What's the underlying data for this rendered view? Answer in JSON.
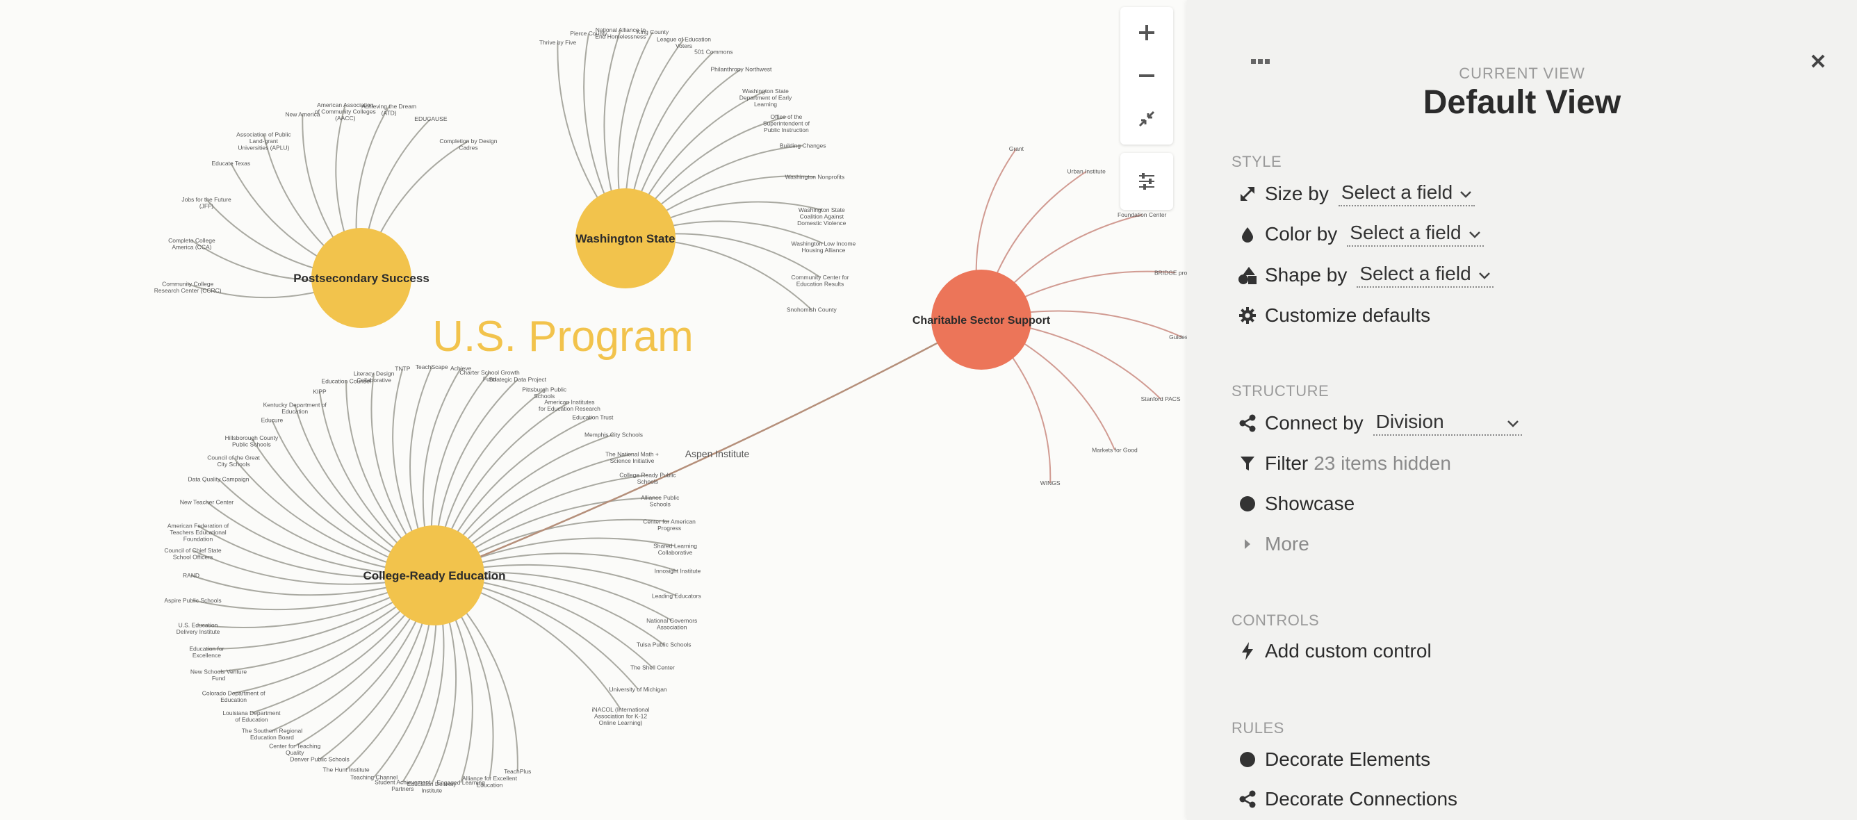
{
  "graph": {
    "region_label": "U.S. Program",
    "hubs": [
      {
        "id": "postsecondary",
        "name": "Postsecondary Success",
        "color": "#f2c34c",
        "line_color": "#9a9a92",
        "leaves": [
          "Community College Research Center (CCRC)",
          "Complete College America (CCA)",
          "Jobs for the Future (JFF)",
          "Educate Texas",
          "Association of Public Land-grant Universities (APLU)",
          "New America",
          "American Association of Community Colleges (AACC)",
          "Achieving the Dream (ATD)",
          "EDUCAUSE",
          "Completion by Design Cadres"
        ]
      },
      {
        "id": "washington",
        "name": "Washington State",
        "color": "#f2c34c",
        "line_color": "#9a9a92",
        "leaves": [
          "Thrive by Five",
          "Pierce County",
          "National Alliance to End Homelessness",
          "King County",
          "League of Education Voters",
          "501 Commons",
          "Philanthropy Northwest",
          "Washington State Department of Early Learning",
          "Office of the Superintendent of Public Instruction",
          "Building Changes",
          "Washington Nonprofits",
          "Washington State Coalition Against Domestic Violence",
          "Washington Low Income Housing Alliance",
          "Community Center for Education Results",
          "Snohomish County"
        ]
      },
      {
        "id": "college_ready",
        "name": "College-Ready Education",
        "color": "#f2c34c",
        "line_color": "#9a9a92",
        "leaves": [
          "TeachPlus",
          "Alliance for Excellent Education",
          "Engaged Learning",
          "Education Delivery Institute",
          "Student Achievement Partners",
          "Teaching Channel",
          "The Hunt Institute",
          "Denver Public Schools",
          "Center for Teaching Quality",
          "The Southern Regional Education Board",
          "Louisiana Department of Education",
          "Colorado Department of Education",
          "New Schools Venture Fund",
          "Education for Excellence",
          "U.S. Education Delivery Institute",
          "Aspire Public Schools",
          "RAND",
          "Council of Chief State School Officers",
          "American Federation of Teachers Educational Foundation",
          "New Teacher Center",
          "Data Quality Campaign",
          "Council of the Great City Schools",
          "Hillsborough County Public Schools",
          "Educure",
          "Kentucky Department of Education",
          "KIPP",
          "Education Counsel",
          "Literacy Design Collaborative",
          "TNTP",
          "TeachScape",
          "Achieve",
          "Charter School Growth Fund",
          "Strategic Data Project",
          "Pittsburgh Public Schools",
          "American Institutes for Education Research",
          "Education Trust",
          "Memphis City Schools",
          "The National Math + Science Initiative",
          "College Ready Public Schools",
          "Alliance Public Schools",
          "Center for American Progress",
          "Shared Learning Collaborative",
          "Innosight Institute",
          "Leading Educators",
          "National Governors Association",
          "Tulsa Public Schools",
          "The Shell Center",
          "University of Michigan",
          "iNACOL (International Association for K-12 Online Learning)"
        ]
      },
      {
        "id": "charitable",
        "name": "Charitable Sector Support",
        "color": "#ec7559",
        "line_color": "#c98a80",
        "leaves": [
          "Grant",
          "Urban Institute",
          "Foundation Center",
          "BRIDGE project",
          "Guidestar",
          "Stanford PACS",
          "Markets for Good",
          "WINGS"
        ]
      }
    ],
    "bridge_label": "Aspen Institute"
  },
  "zoom": {
    "zoom_in_icon": "plus-icon",
    "zoom_out_icon": "minus-icon",
    "fit_icon": "compress-icon",
    "settings_icon": "sliders-icon"
  },
  "panel": {
    "caption": "CURRENT VIEW",
    "title": "Default View",
    "style": {
      "heading": "STYLE",
      "size_label": "Size by",
      "size_value": "Select a field",
      "color_label": "Color by",
      "color_value": "Select a field",
      "shape_label": "Shape by",
      "shape_value": "Select a field",
      "customize_label": "Customize defaults"
    },
    "structure": {
      "heading": "STRUCTURE",
      "connect_label": "Connect by",
      "connect_value": "Division",
      "filter_label": "Filter",
      "filter_value": "23 items hidden",
      "showcase_label": "Showcase",
      "more_label": "More"
    },
    "controls": {
      "heading": "CONTROLS",
      "add_label": "Add custom control"
    },
    "rules": {
      "heading": "RULES",
      "elements_label": "Decorate Elements",
      "connections_label": "Decorate Connections"
    }
  }
}
